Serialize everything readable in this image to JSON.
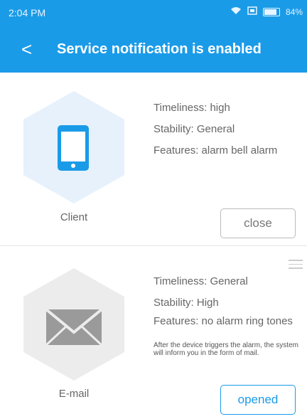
{
  "status": {
    "time": "2:04 PM",
    "battery": "84%"
  },
  "header": {
    "back": "<",
    "title": "Service notification is enabled"
  },
  "client": {
    "label": "Client",
    "timeliness": "Timeliness: high",
    "stability": "Stability: General",
    "features": "Features: alarm bell alarm",
    "button": "close"
  },
  "email": {
    "label": "E-mail",
    "timeliness": "Timeliness: General",
    "stability": "Stability: High",
    "features": "Features: no alarm ring tones",
    "note": "After the device triggers the alarm, the system will inform you in the form of mail.",
    "button": "opened"
  },
  "colors": {
    "accent": "#1a9be8",
    "hex_active": "#e6f1fb",
    "hex_inactive": "#ececec"
  }
}
